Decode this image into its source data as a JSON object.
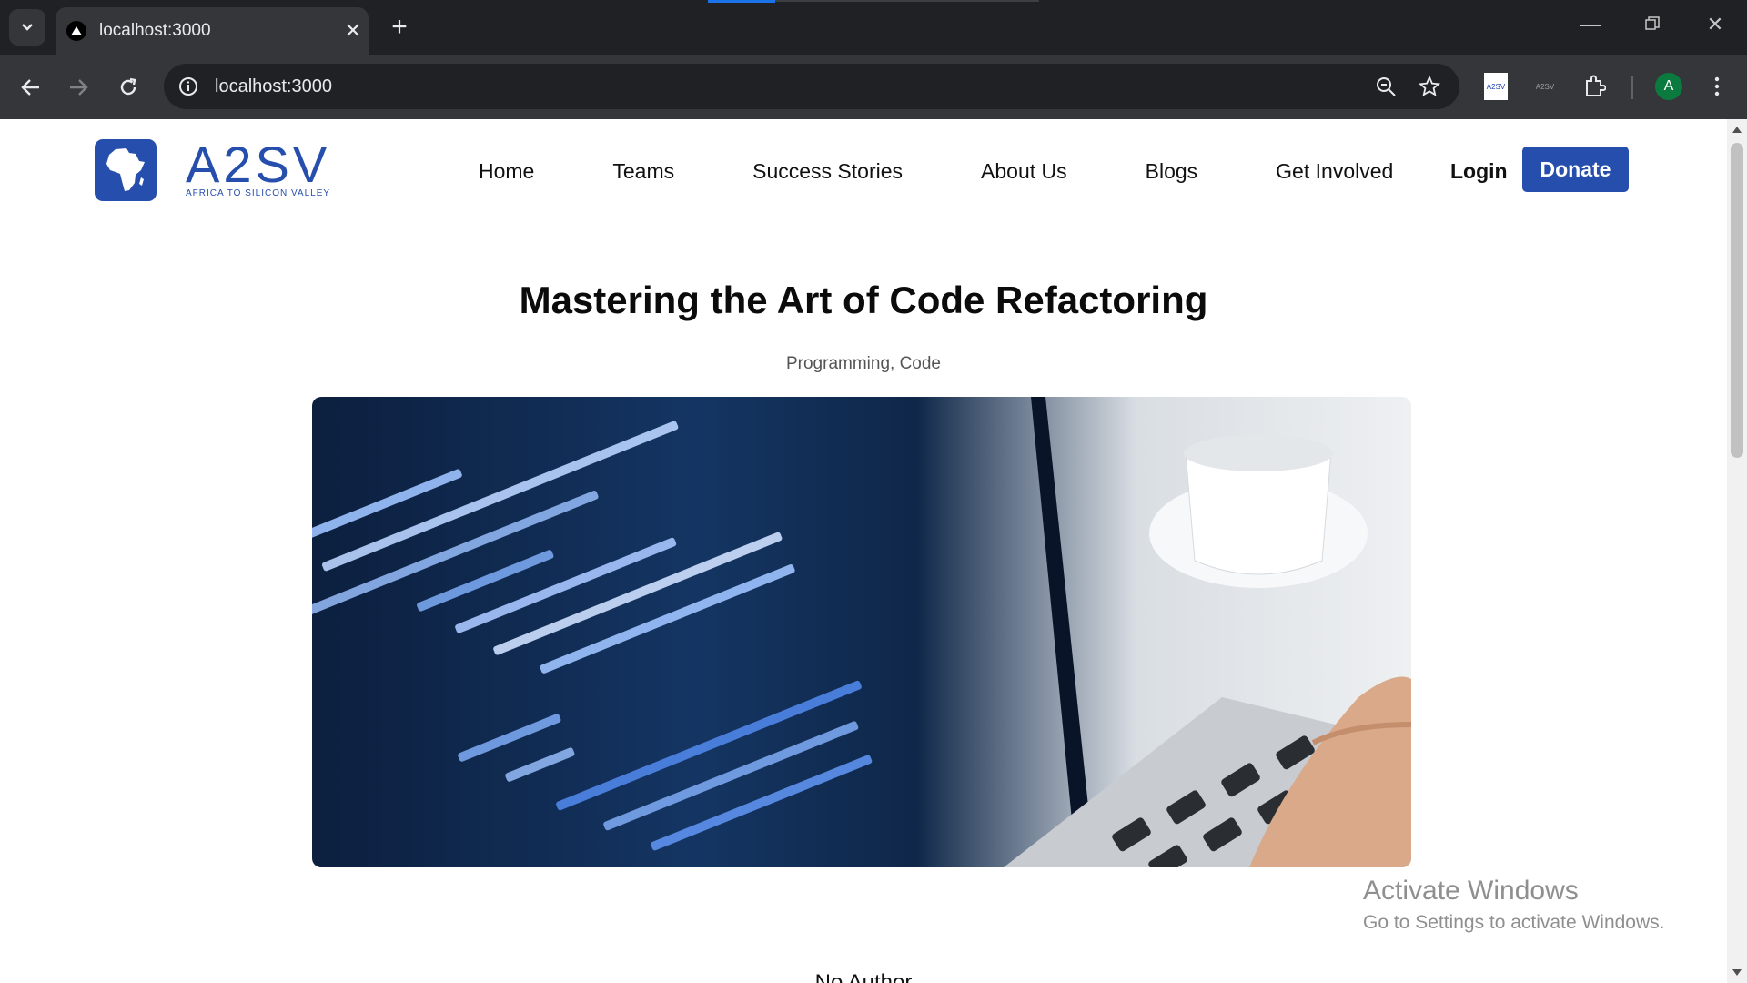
{
  "browser": {
    "tab_title": "localhost:3000",
    "url": "localhost:3000",
    "profile_initial": "A",
    "extensions": [
      "A2SV",
      "A2SV"
    ]
  },
  "site": {
    "logo_wordmark": "A2SV",
    "logo_tagline": "AFRICA TO SILICON VALLEY",
    "brand_color": "#264fad",
    "nav": [
      "Home",
      "Teams",
      "Success Stories",
      "About Us",
      "Blogs",
      "Get Involved"
    ],
    "login_label": "Login",
    "donate_label": "Donate"
  },
  "post": {
    "title": "Mastering the Art of Code Refactoring",
    "tags": "Programming, Code",
    "author_peek": "No Author"
  },
  "overlay": {
    "activate_title": "Activate Windows",
    "activate_sub": "Go to Settings to activate Windows."
  }
}
